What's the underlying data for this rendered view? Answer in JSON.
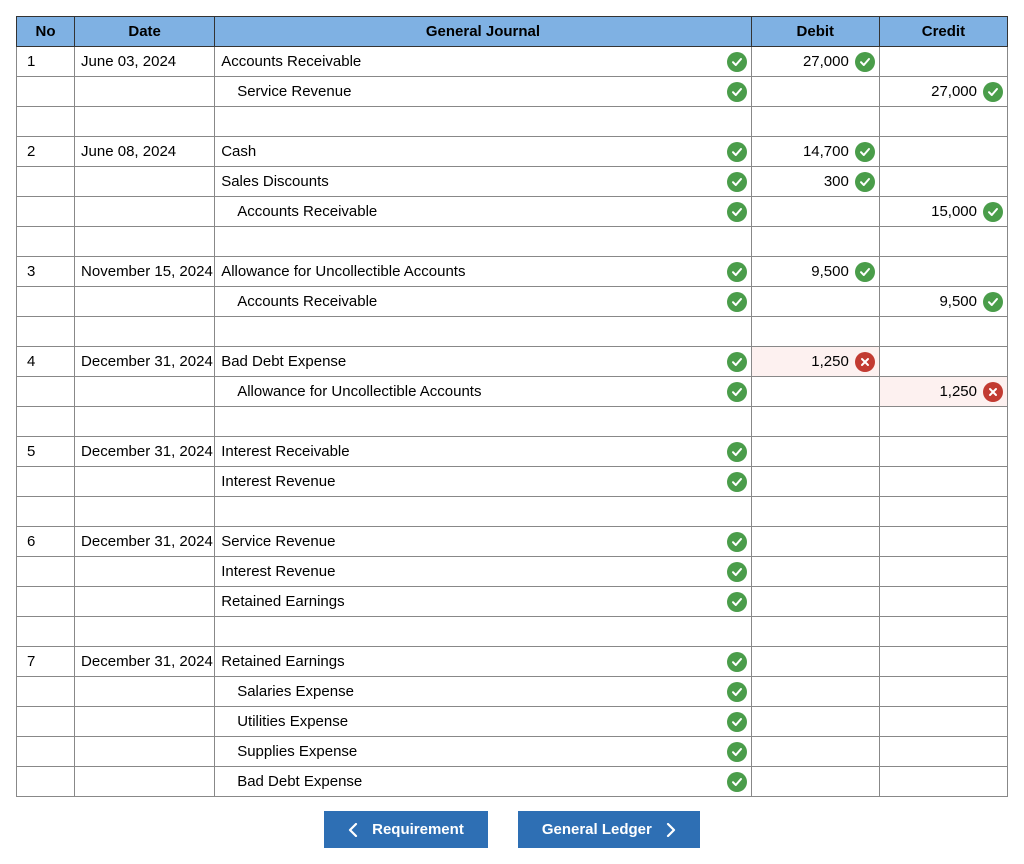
{
  "headers": {
    "no": "No",
    "date": "Date",
    "gj": "General Journal",
    "debit": "Debit",
    "credit": "Credit"
  },
  "nav": {
    "prev": "Requirement",
    "next": "General Ledger"
  },
  "rows": [
    {
      "no": "1",
      "date": "June 03, 2024",
      "acc": "Accounts Receivable",
      "ind": 0,
      "accMark": "ok",
      "debit": "27,000",
      "debitMark": "ok",
      "credit": "",
      "creditMark": ""
    },
    {
      "no": "",
      "date": "",
      "acc": "Service Revenue",
      "ind": 1,
      "accMark": "ok",
      "debit": "",
      "debitMark": "",
      "credit": "27,000",
      "creditMark": "ok"
    },
    {
      "blank": true
    },
    {
      "no": "2",
      "date": "June 08, 2024",
      "acc": "Cash",
      "ind": 0,
      "accMark": "ok",
      "debit": "14,700",
      "debitMark": "ok",
      "credit": "",
      "creditMark": ""
    },
    {
      "no": "",
      "date": "",
      "acc": "Sales Discounts",
      "ind": 0,
      "accMark": "ok",
      "debit": "300",
      "debitMark": "ok",
      "credit": "",
      "creditMark": ""
    },
    {
      "no": "",
      "date": "",
      "acc": "Accounts Receivable",
      "ind": 1,
      "accMark": "ok",
      "debit": "",
      "debitMark": "",
      "credit": "15,000",
      "creditMark": "ok"
    },
    {
      "blank": true
    },
    {
      "no": "3",
      "date": "November 15, 2024",
      "acc": "Allowance for Uncollectible Accounts",
      "ind": 0,
      "accMark": "ok",
      "debit": "9,500",
      "debitMark": "ok",
      "credit": "",
      "creditMark": ""
    },
    {
      "no": "",
      "date": "",
      "acc": "Accounts Receivable",
      "ind": 1,
      "accMark": "ok",
      "debit": "",
      "debitMark": "",
      "credit": "9,500",
      "creditMark": "ok"
    },
    {
      "blank": true
    },
    {
      "no": "4",
      "date": "December 31, 2024",
      "acc": "Bad Debt Expense",
      "ind": 0,
      "accMark": "ok",
      "debit": "1,250",
      "debitMark": "bad",
      "credit": "",
      "creditMark": ""
    },
    {
      "no": "",
      "date": "",
      "acc": "Allowance for Uncollectible Accounts",
      "ind": 1,
      "accMark": "ok",
      "debit": "",
      "debitMark": "",
      "credit": "1,250",
      "creditMark": "bad"
    },
    {
      "blank": true
    },
    {
      "no": "5",
      "date": "December 31, 2024",
      "acc": "Interest Receivable",
      "ind": 0,
      "accMark": "ok",
      "debit": "",
      "debitMark": "",
      "credit": "",
      "creditMark": ""
    },
    {
      "no": "",
      "date": "",
      "acc": "Interest Revenue",
      "ind": 0,
      "accMark": "ok",
      "debit": "",
      "debitMark": "",
      "credit": "",
      "creditMark": ""
    },
    {
      "blank": true
    },
    {
      "no": "6",
      "date": "December 31, 2024",
      "acc": "Service Revenue",
      "ind": 0,
      "accMark": "ok",
      "debit": "",
      "debitMark": "",
      "credit": "",
      "creditMark": ""
    },
    {
      "no": "",
      "date": "",
      "acc": "Interest Revenue",
      "ind": 0,
      "accMark": "ok",
      "debit": "",
      "debitMark": "",
      "credit": "",
      "creditMark": ""
    },
    {
      "no": "",
      "date": "",
      "acc": "Retained Earnings",
      "ind": 0,
      "accMark": "ok",
      "debit": "",
      "debitMark": "",
      "credit": "",
      "creditMark": ""
    },
    {
      "blank": true
    },
    {
      "no": "7",
      "date": "December 31, 2024",
      "acc": "Retained Earnings",
      "ind": 0,
      "accMark": "ok",
      "debit": "",
      "debitMark": "",
      "credit": "",
      "creditMark": ""
    },
    {
      "no": "",
      "date": "",
      "acc": "Salaries Expense",
      "ind": 1,
      "accMark": "ok",
      "debit": "",
      "debitMark": "",
      "credit": "",
      "creditMark": ""
    },
    {
      "no": "",
      "date": "",
      "acc": "Utilities Expense",
      "ind": 1,
      "accMark": "ok",
      "debit": "",
      "debitMark": "",
      "credit": "",
      "creditMark": ""
    },
    {
      "no": "",
      "date": "",
      "acc": "Supplies Expense",
      "ind": 1,
      "accMark": "ok",
      "debit": "",
      "debitMark": "",
      "credit": "",
      "creditMark": ""
    },
    {
      "no": "",
      "date": "",
      "acc": "Bad Debt Expense",
      "ind": 1,
      "accMark": "ok",
      "debit": "",
      "debitMark": "",
      "credit": "",
      "creditMark": ""
    }
  ]
}
